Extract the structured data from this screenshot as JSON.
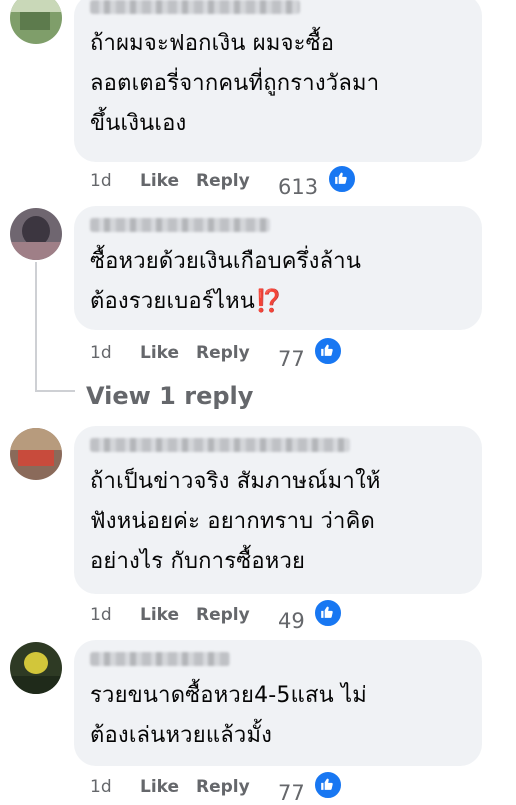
{
  "comments": [
    {
      "text": "ถ้าผมจะฟอกเงิน ผมจะซื้อ\nลอตเตอรี่จากคนที่ถูกรางวัลมา\nขึ้นเงินเอง",
      "time": "1d",
      "like_label": "Like",
      "reply_label": "Reply",
      "reaction_count": "613"
    },
    {
      "text": "ซื้อหวยด้วยเงินเกือบครึ่งล้าน\nต้องรวยเบอร์ไหน⁉️",
      "time": "1d",
      "like_label": "Like",
      "reply_label": "Reply",
      "reaction_count": "77"
    },
    {
      "text": "ถ้าเป็นข่าวจริง สัมภาษณ์มาให้\nฟังหน่อยค่ะ อยากทราบ ว่าคิด\nอย่างไร กับการซื้อหวย",
      "time": "1d",
      "like_label": "Like",
      "reply_label": "Reply",
      "reaction_count": "49"
    },
    {
      "text": "รวยขนาดซื้อหวย4-5แสน ไม่\nต้องเล่นหวยแล้วมั้ง",
      "time": "1d",
      "like_label": "Like",
      "reply_label": "Reply",
      "reaction_count": "77"
    }
  ],
  "view_replies_label": "View 1 reply",
  "colors": {
    "like_blue": "#1877f2",
    "bubble": "#f0f2f5",
    "meta_gray": "#65676b"
  },
  "icons": [
    "like-icon"
  ]
}
